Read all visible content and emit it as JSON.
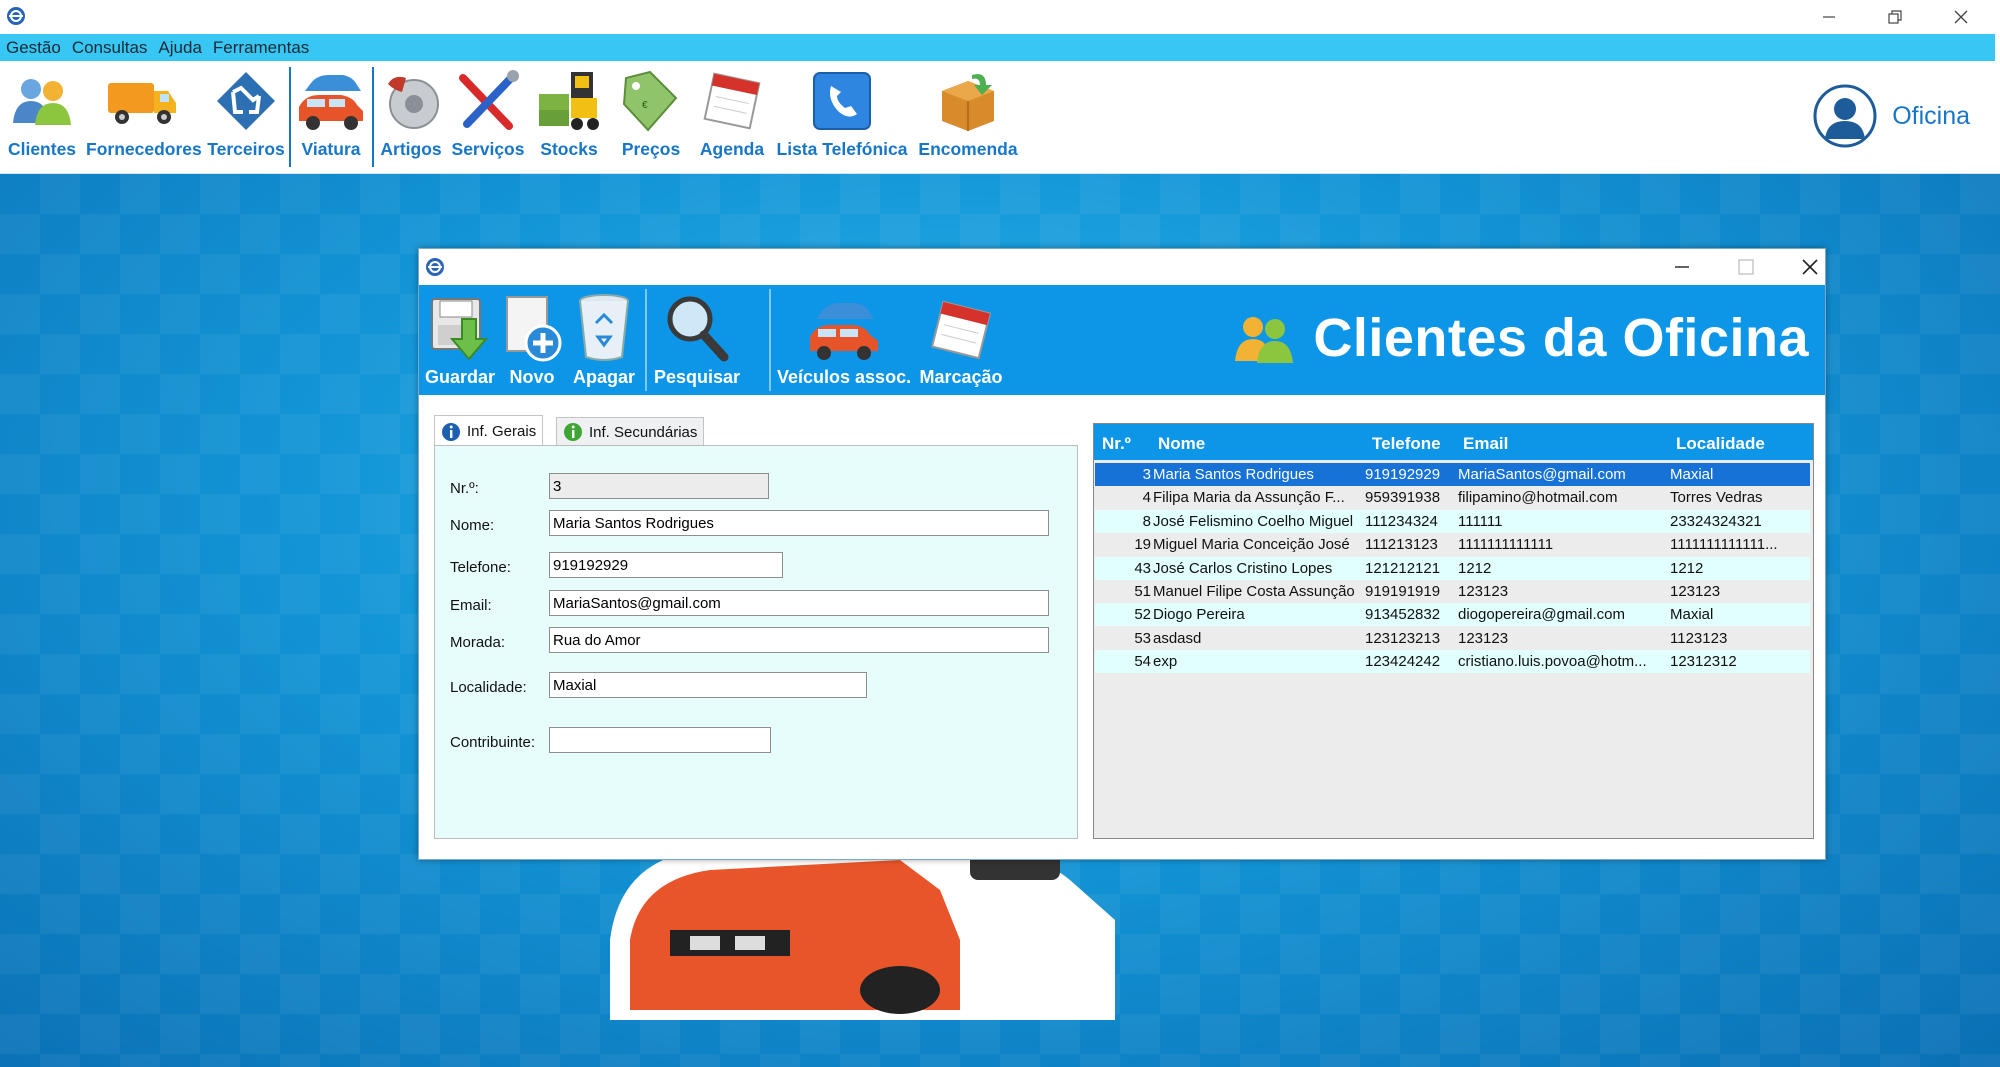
{
  "menu": [
    "Gestão",
    "Consultas",
    "Ajuda",
    "Ferramentas"
  ],
  "toolbar": {
    "clientes": "Clientes",
    "fornecedores": "Fornecedores",
    "terceiros": "Terceiros",
    "viatura": "Viatura",
    "artigos": "Artigos",
    "servicos": "Serviços",
    "stocks": "Stocks",
    "precos": "Preços",
    "agenda": "Agenda",
    "lista_telefonica": "Lista Telefónica",
    "encomenda": "Encomenda"
  },
  "user": {
    "name": "Oficina"
  },
  "colors": {
    "accent": "#0d95e8",
    "menubar": "#38c6f4",
    "toolbar_label": "#1876c9",
    "form_bg": "#e7fdfb",
    "selection": "#1672d6"
  },
  "dialog": {
    "title": "Clientes da Oficina",
    "toolbar": {
      "guardar": "Guardar",
      "novo": "Novo",
      "apagar": "Apagar",
      "pesquisar": "Pesquisar",
      "veiculos": "Veículos assoc.",
      "marcacao": "Marcação"
    },
    "tabs": [
      "Inf. Gerais",
      "Inf. Secundárias"
    ],
    "form": {
      "nr_label": "Nr.º:",
      "nr_value": "3",
      "nome_label": "Nome:",
      "nome_value": "Maria Santos Rodrigues",
      "telefone_label": "Telefone:",
      "telefone_value": "919192929",
      "email_label": "Email:",
      "email_value": "MariaSantos@gmail.com",
      "morada_label": "Morada:",
      "morada_value": "Rua do Amor",
      "localidade_label": "Localidade:",
      "localidade_value": "Maxial",
      "contribuinte_label": "Contribuinte:",
      "contribuinte_value": ""
    },
    "grid": {
      "columns": [
        "Nr.º",
        "Nome",
        "Telefone",
        "Email",
        "Localidade"
      ],
      "rows": [
        [
          "3",
          "Maria Santos Rodrigues",
          "919192929",
          "MariaSantos@gmail.com",
          "Maxial"
        ],
        [
          "4",
          "Filipa Maria da Assunção F...",
          "959391938",
          "filipamino@hotmail.com",
          "Torres Vedras"
        ],
        [
          "8",
          "José Felismino Coelho Miguel",
          "111234324",
          "111111",
          "23324324321"
        ],
        [
          "19",
          "Miguel Maria Conceição José",
          "111213123",
          "1111111111111",
          "1111111111111..."
        ],
        [
          "43",
          "José Carlos Cristino Lopes",
          "121212121",
          "1212",
          "1212"
        ],
        [
          "51",
          "Manuel Filipe Costa Assunção",
          "919191919",
          "123123",
          "123123"
        ],
        [
          "52",
          "Diogo Pereira",
          "913452832",
          "diogopereira@gmail.com",
          "Maxial"
        ],
        [
          "53",
          "asdasd",
          "123123213",
          "123123",
          "1123123"
        ],
        [
          "54",
          "exp",
          "123424242",
          "cristiano.luis.povoa@hotm...",
          "12312312"
        ]
      ]
    }
  }
}
